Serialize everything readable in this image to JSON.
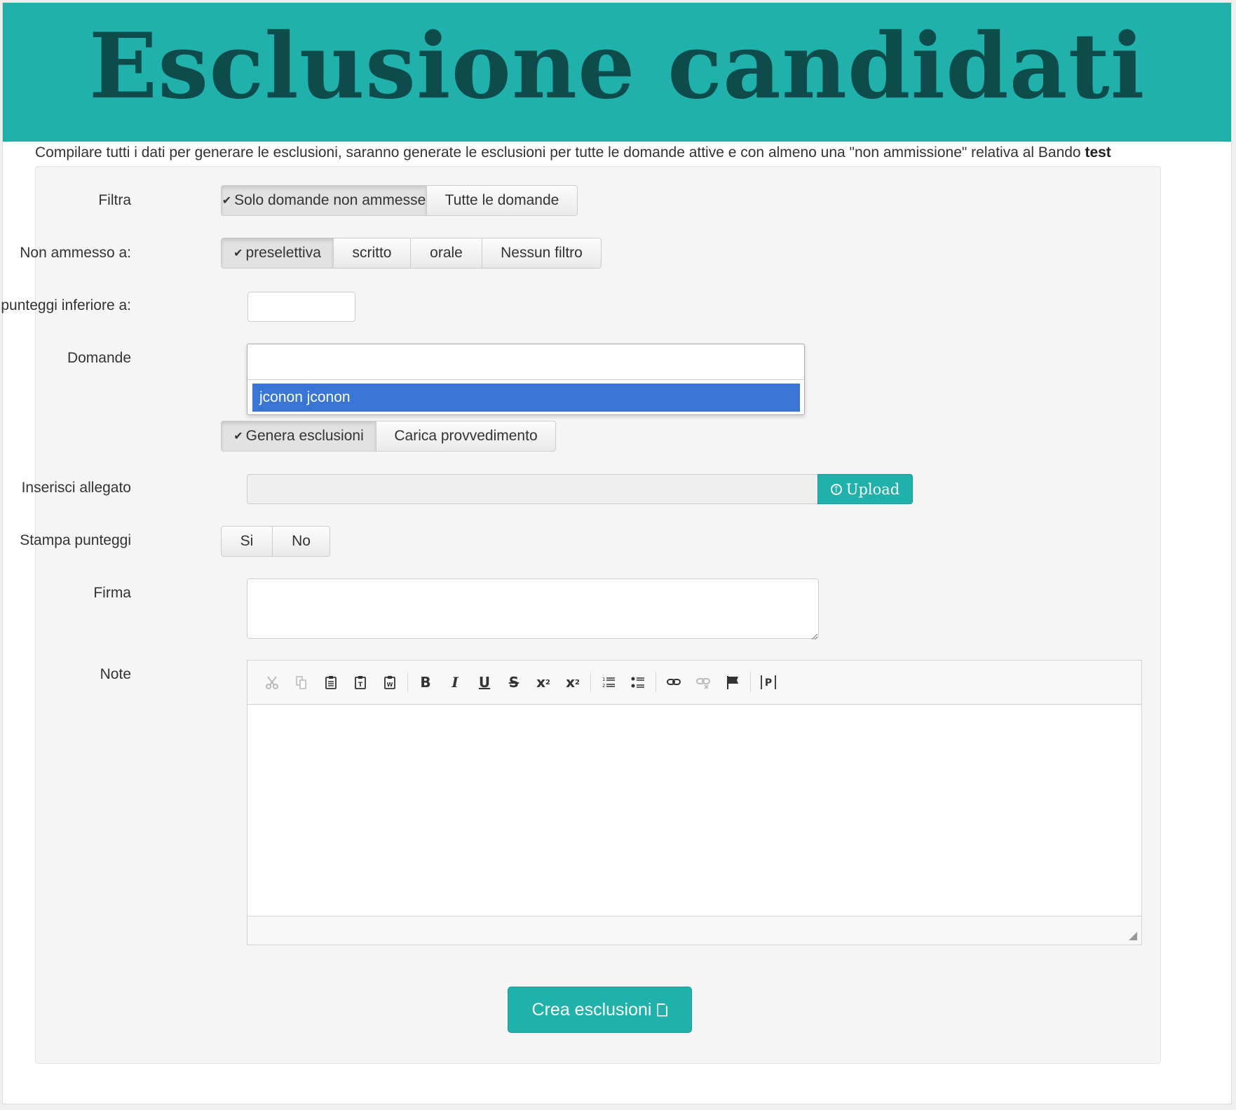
{
  "header": {
    "title": "Esclusione candidati"
  },
  "intro": {
    "text": "Compilare tutti i dati per generare le esclusioni, saranno generate le esclusioni per tutte le domande attive e con almeno una \"non ammissione\" relativa al Bando ",
    "bando": "test"
  },
  "form": {
    "filtra": {
      "label": "Filtra",
      "options": [
        "Solo domande non ammesse",
        "Tutte le domande"
      ],
      "selected": "Solo domande non ammesse"
    },
    "non_ammesso": {
      "label": "Non ammesso a:",
      "options": [
        "preselettiva",
        "scritto",
        "orale",
        "Nessun filtro"
      ],
      "selected": "preselettiva"
    },
    "punteggi": {
      "label": "Tot. punteggi inferiore a:",
      "value": ""
    },
    "domande": {
      "label": "Domande",
      "search_value": "",
      "highlighted_option": "jconon jconon"
    },
    "azione": {
      "options": [
        "Genera esclusioni",
        "Carica provvedimento"
      ],
      "selected": "Genera esclusioni"
    },
    "allegato": {
      "label": "Inserisci allegato",
      "button": "Upload"
    },
    "stampa": {
      "label": "Stampa punteggi",
      "options": [
        "Si",
        "No"
      ]
    },
    "firma": {
      "label": "Firma",
      "value": ""
    },
    "note": {
      "label": "Note"
    },
    "submit": "Crea esclusioni"
  },
  "icons": {
    "check": "checkmark-icon",
    "upload": "arrow-up-circle-icon",
    "submit": "file-icon"
  },
  "colors": {
    "accent": "#20b2aa",
    "title": "#0d4c4b",
    "highlight": "#3875d7"
  }
}
